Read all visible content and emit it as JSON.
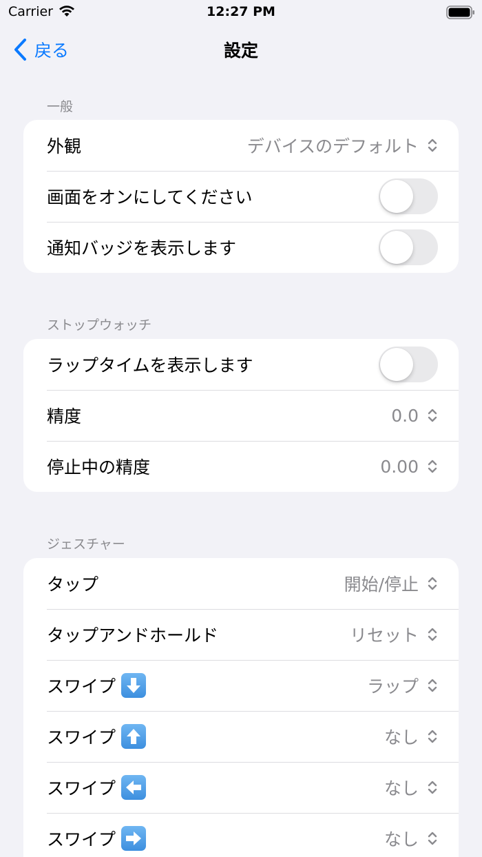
{
  "status_bar": {
    "carrier": "Carrier",
    "time": "12:27 PM"
  },
  "nav": {
    "back_label": "戻る",
    "title": "設定"
  },
  "sections": {
    "general": {
      "header": "一般",
      "appearance": {
        "label": "外観",
        "value": "デバイスのデフォルト"
      },
      "keep_screen_on": {
        "label": "画面をオンにしてください",
        "on": false
      },
      "show_badge": {
        "label": "通知バッジを表示します",
        "on": false
      }
    },
    "stopwatch": {
      "header": "ストップウォッチ",
      "show_lap_time": {
        "label": "ラップタイムを表示します",
        "on": false
      },
      "precision": {
        "label": "精度",
        "value": "0.0"
      },
      "paused_precision": {
        "label": "停止中の精度",
        "value": "0.00"
      }
    },
    "gestures": {
      "header": "ジェスチャー",
      "tap": {
        "label": "タップ",
        "value": "開始/停止"
      },
      "tap_hold": {
        "label": "タップアンドホールド",
        "value": "リセット"
      },
      "swipe_down": {
        "label": "スワイプ",
        "value": "ラップ",
        "icon": "arrow-down-icon"
      },
      "swipe_up": {
        "label": "スワイプ",
        "value": "なし",
        "icon": "arrow-up-icon"
      },
      "swipe_left": {
        "label": "スワイプ",
        "value": "なし",
        "icon": "arrow-left-icon"
      },
      "swipe_right": {
        "label": "スワイプ",
        "value": "なし",
        "icon": "arrow-right-icon"
      }
    }
  },
  "colors": {
    "accent": "#0a7aff",
    "background": "#f2f2f7",
    "secondary_text": "#8a8a8e",
    "toggle_off": "#e9e9eb"
  }
}
